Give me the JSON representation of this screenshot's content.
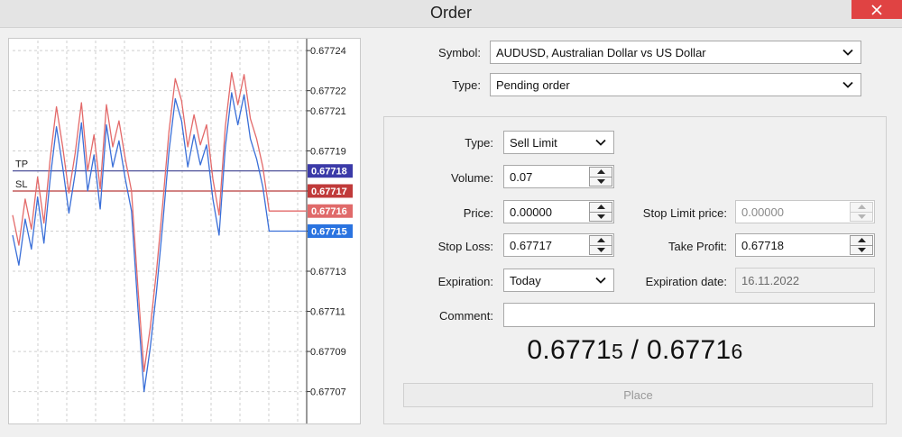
{
  "window": {
    "title": "Order"
  },
  "symbol": {
    "label": "Symbol:",
    "value": "AUDUSD, Australian Dollar vs US Dollar"
  },
  "order_type": {
    "label": "Type:",
    "value": "Pending order"
  },
  "pending": {
    "type": {
      "label": "Type:",
      "value": "Sell Limit"
    },
    "volume": {
      "label": "Volume:",
      "value": "0.07"
    },
    "price": {
      "label": "Price:",
      "value": "0.00000"
    },
    "stop_limit_price": {
      "label": "Stop Limit price:",
      "value": "0.00000"
    },
    "stop_loss": {
      "label": "Stop Loss:",
      "value": "0.67717"
    },
    "take_profit": {
      "label": "Take Profit:",
      "value": "0.67718"
    },
    "expiration": {
      "label": "Expiration:",
      "value": "Today"
    },
    "expiration_date": {
      "label": "Expiration date:",
      "value": "16.11.2022"
    },
    "comment": {
      "label": "Comment:",
      "value": ""
    }
  },
  "quote": {
    "bid_main": "0.6771",
    "bid_last": "5",
    "separator": " / ",
    "ask_main": "0.6771",
    "ask_last": "6"
  },
  "place_button": {
    "label": "Place"
  },
  "colors": {
    "bid_line": "#3a6fd8",
    "ask_line": "#e36a6a",
    "tp_line": "#3b3f8f",
    "sl_line": "#b83a3a",
    "tp_tag": "#3b3aa8",
    "sl_tag": "#c03a3a",
    "ask_tag": "#e06a6a",
    "bid_tag": "#2a73e0"
  },
  "chart_data": {
    "type": "line",
    "ylim": [
      0.677055,
      0.677245
    ],
    "yticks": [
      "0.67724",
      "0.67722",
      "0.67721",
      "0.67719",
      "0.67717",
      "0.67715",
      "0.67713",
      "0.67711",
      "0.67709",
      "0.67707"
    ],
    "tp": {
      "label": "TP",
      "value": 0.67718,
      "tag": "0.67718"
    },
    "sl": {
      "label": "SL",
      "value": 0.67717,
      "tag": "0.67717"
    },
    "ask_tag": "0.67716",
    "bid_tag": "0.67715",
    "x": [
      0,
      1,
      2,
      3,
      4,
      5,
      6,
      7,
      8,
      9,
      10,
      11,
      12,
      13,
      14,
      15,
      16,
      17,
      18,
      19,
      20,
      21,
      22,
      23,
      24,
      25,
      26,
      27,
      28,
      29,
      30,
      31,
      32,
      33,
      34,
      35,
      36,
      37,
      38,
      39,
      40,
      41,
      42,
      43,
      44,
      45,
      46,
      47
    ],
    "series": [
      {
        "values": [
          0.677148,
          0.677133,
          0.677156,
          0.677141,
          0.677167,
          0.677144,
          0.677176,
          0.677202,
          0.677182,
          0.677159,
          0.677179,
          0.677204,
          0.67717,
          0.677188,
          0.677161,
          0.677203,
          0.677182,
          0.677195,
          0.677176,
          0.67716,
          0.677113,
          0.67707,
          0.677092,
          0.67712,
          0.677154,
          0.67719,
          0.677216,
          0.677205,
          0.677182,
          0.677198,
          0.677183,
          0.677193,
          0.677166,
          0.677148,
          0.677192,
          0.677219,
          0.677203,
          0.677218,
          0.677196,
          0.677186,
          0.677172,
          0.67715,
          0.67715,
          0.67715,
          0.67715,
          0.67715,
          0.67715,
          0.67715
        ]
      },
      {
        "values": [
          0.677158,
          0.677143,
          0.677166,
          0.677151,
          0.677177,
          0.677154,
          0.677186,
          0.677212,
          0.677192,
          0.677169,
          0.677189,
          0.677214,
          0.67718,
          0.677198,
          0.677171,
          0.677213,
          0.677192,
          0.677205,
          0.677186,
          0.67717,
          0.677123,
          0.67708,
          0.677102,
          0.67713,
          0.677164,
          0.6772,
          0.677226,
          0.677215,
          0.677192,
          0.677208,
          0.677193,
          0.677203,
          0.677176,
          0.677158,
          0.677202,
          0.677229,
          0.677213,
          0.677228,
          0.677206,
          0.677196,
          0.677182,
          0.67716,
          0.67716,
          0.67716,
          0.67716,
          0.67716,
          0.67716,
          0.67716
        ]
      }
    ]
  }
}
